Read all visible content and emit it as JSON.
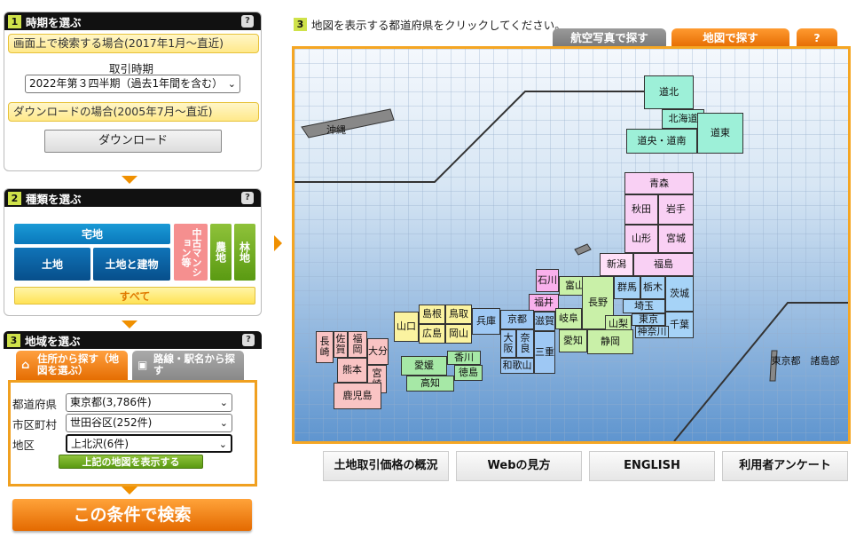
{
  "step1": {
    "num": "1",
    "title": "時期を選ぶ",
    "help": "?",
    "screen_label": "画面上で検索する場合(2017年1月～直近)",
    "period_label": "取引時期",
    "period_value": "2022年第３四半期（過去1年間を含む）",
    "download_label": "ダウンロードの場合(2005年7月～直近)",
    "download_button": "ダウンロード"
  },
  "step2": {
    "num": "2",
    "title": "種類を選ぶ",
    "help": "?",
    "btn_takuchi": "宅地",
    "btn_tochi": "土地",
    "btn_tochi_tatemono": "土地と建物",
    "btn_mansion": "中古マンション等",
    "btn_nouchi": "農地",
    "btn_rinchi": "林地",
    "btn_all": "すべて"
  },
  "step3": {
    "num": "3",
    "title": "地域を選ぶ",
    "help": "?",
    "tab_address": "住所から探す（地図を選ぶ）",
    "tab_station": "路線・駅名から探す",
    "pref_label": "都道府県",
    "pref_value": "東京都(3,786件)",
    "city_label": "市区町村",
    "city_value": "世田谷区(252件)",
    "area_label": "地区",
    "area_value": "上北沢(6件)",
    "show_map_button": "上記の地図を表示する"
  },
  "search_button": "この条件で検索",
  "map": {
    "num": "3",
    "instruction": "地図を表示する都道府県をクリックしてください。",
    "tab_aerial": "航空写真で探す",
    "tab_map": "地図で探す",
    "tab_help": "?",
    "okinawa": "沖縄",
    "tokyo_islands": "東京都　諸島部",
    "prefs": {
      "hokkaido_north": "道北",
      "hokkaido_central": "道央・道南",
      "hokkaido": "北海道",
      "hokkaido_east": "道東",
      "aomori": "青森",
      "akita": "秋田",
      "iwate": "岩手",
      "yamagata": "山形",
      "miyagi": "宮城",
      "fukushima": "福島",
      "niigata": "新潟",
      "ishikawa": "石川",
      "toyama": "富山",
      "fukui": "福井",
      "nagano": "長野",
      "gunma": "群馬",
      "tochigi": "栃木",
      "ibaraki": "茨城",
      "saitama": "埼玉",
      "tokyo": "東京",
      "chiba": "千葉",
      "kanagawa": "神奈川",
      "yamanashi": "山梨",
      "shizuoka": "静岡",
      "aichi": "愛知",
      "gifu": "岐阜",
      "shiga": "滋賀",
      "kyoto": "京都",
      "osaka": "大阪",
      "nara": "奈良",
      "wakayama": "和歌山",
      "mie": "三重",
      "hyogo": "兵庫",
      "tottori": "鳥取",
      "shimane": "島根",
      "okayama": "岡山",
      "hiroshima": "広島",
      "yamaguchi": "山口",
      "kagawa": "香川",
      "ehime": "愛媛",
      "tokushima": "徳島",
      "kochi": "高知",
      "fukuoka": "福岡",
      "saga": "佐賀",
      "nagasaki": "長崎",
      "oita": "大分",
      "kumamoto": "熊本",
      "miyazaki": "宮崎",
      "kagoshima": "鹿児島"
    }
  },
  "bottom": {
    "overview": "土地取引価格の概況",
    "howto": "Webの見方",
    "english": "ENGLISH",
    "survey": "利用者アンケート"
  },
  "colors": {
    "accent_orange": "#e46a00",
    "step_green": "#cfe24a",
    "map_border": "#f5a623"
  }
}
